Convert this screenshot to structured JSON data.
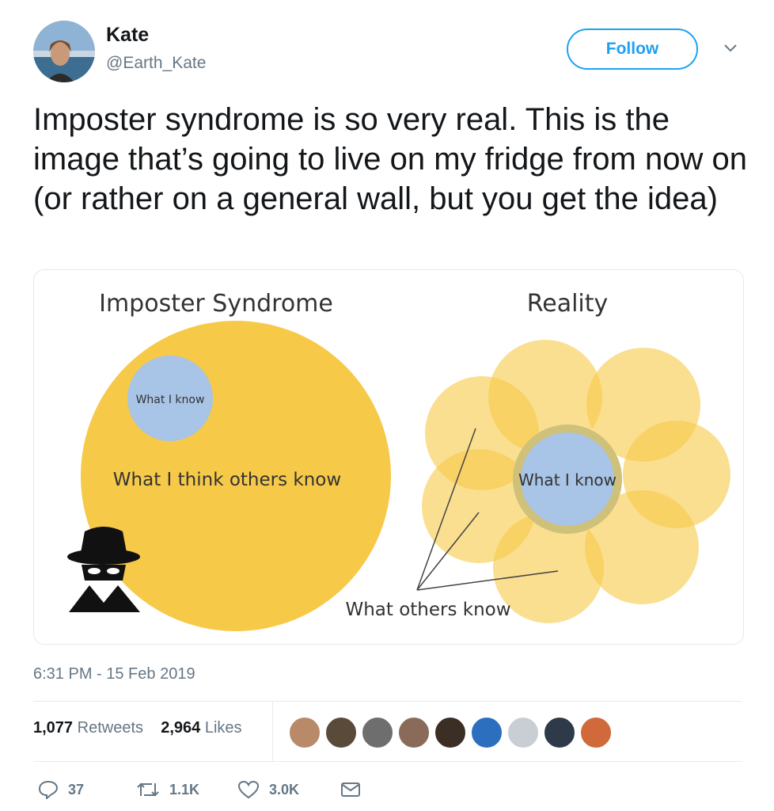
{
  "author": {
    "name": "Kate",
    "handle": "@Earth_Kate"
  },
  "follow_button": {
    "label": "Follow"
  },
  "tweet": {
    "text": "Imposter syndrome is so very real. This is the image that’s going to live on my fridge from now on (or rather on a general wall, but you get the idea)",
    "timestamp": "6:31 PM - 15 Feb 2019"
  },
  "image": {
    "left_title": "Imposter Syndrome",
    "right_title": "Reality",
    "what_i_know": "What I know",
    "what_i_think_others_know": "What I think others know",
    "what_others_know": "What others know"
  },
  "stats": {
    "retweets_count": "1,077",
    "retweets_label": "Retweets",
    "likes_count": "2,964",
    "likes_label": "Likes"
  },
  "likers": [
    "liker-1",
    "liker-2",
    "liker-3",
    "liker-4",
    "liker-5",
    "liker-6",
    "liker-7",
    "liker-8",
    "liker-9"
  ],
  "actions": {
    "reply_count": "37",
    "retweet_count": "1.1K",
    "like_count": "3.0K"
  },
  "colors": {
    "accent": "#1da1f2",
    "circle_yellow": "#f7c948",
    "knowledge_blue": "#a8c4e6"
  }
}
